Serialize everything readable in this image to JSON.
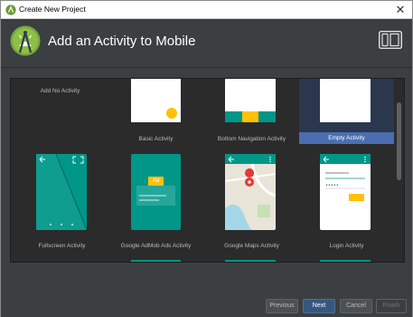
{
  "window": {
    "title": "Create New Project",
    "close_glyph": "✕"
  },
  "header": {
    "heading": "Add an Activity to Mobile",
    "logo_icon": "android-studio-icon",
    "device_icon": "tablet-phone-icon"
  },
  "activities": [
    {
      "label": "Add No Activity",
      "selected": false
    },
    {
      "label": "Basic Activity",
      "selected": false
    },
    {
      "label": "Bottom Navigation Activity",
      "selected": false
    },
    {
      "label": "Empty Activity",
      "selected": true
    },
    {
      "label": "Fullscreen Activity",
      "selected": false
    },
    {
      "label": "Google AdMob Ads Activity",
      "selected": false
    },
    {
      "label": "Google Maps Activity",
      "selected": false
    },
    {
      "label": "Login Activity",
      "selected": false
    }
  ],
  "admob_badge": "Ad",
  "buttons": {
    "previous": "Previous",
    "next": "Next",
    "cancel": "Cancel",
    "finish": "Finish"
  },
  "colors": {
    "accent_teal": "#009688",
    "amber": "#ffc107",
    "selection": "#4b6eaf",
    "primary_button": "#365880"
  }
}
